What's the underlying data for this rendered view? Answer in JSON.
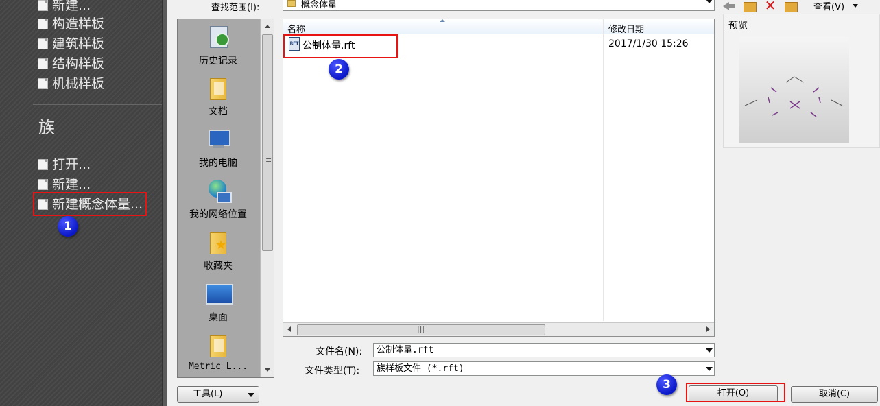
{
  "left_panel": {
    "items_top": [
      {
        "label": "新建..."
      },
      {
        "label": "构造样板"
      },
      {
        "label": "建筑样板"
      },
      {
        "label": "结构样板"
      },
      {
        "label": "机械样板"
      }
    ],
    "section_title": "族",
    "items_family": [
      {
        "label": "打开..."
      },
      {
        "label": "新建..."
      },
      {
        "label": "新建概念体量..."
      }
    ]
  },
  "dialog": {
    "look_in_label": "查找范围(I):",
    "look_in_value": "概念体量",
    "views_label": "查看(V)",
    "places": [
      {
        "label": "历史记录",
        "icon": "history-icon"
      },
      {
        "label": "文档",
        "icon": "documents-folder-icon"
      },
      {
        "label": "我的电脑",
        "icon": "my-computer-icon"
      },
      {
        "label": "我的网络位置",
        "icon": "network-places-icon"
      },
      {
        "label": "收藏夹",
        "icon": "favorites-folder-icon"
      },
      {
        "label": "桌面",
        "icon": "desktop-icon"
      },
      {
        "label": "Metric L...",
        "icon": "folder-icon"
      }
    ],
    "columns": {
      "name": "名称",
      "date": "修改日期"
    },
    "files": [
      {
        "name": "公制体量.rft",
        "date": "2017/1/30 15:26",
        "icon_text": "RFT"
      }
    ],
    "preview_label": "预览",
    "filename_label": "文件名(N):",
    "filename_value": "公制体量.rft",
    "filetype_label": "文件类型(T):",
    "filetype_value": "族样板文件 (*.rft)",
    "tools_label": "工具(L)",
    "open_label": "打开(O)",
    "cancel_label": "取消(C)"
  },
  "annotations": {
    "step1": "1",
    "step2": "2",
    "step3": "3"
  },
  "colors": {
    "highlight_box": "#e81313",
    "badge": "#0a18c8"
  }
}
